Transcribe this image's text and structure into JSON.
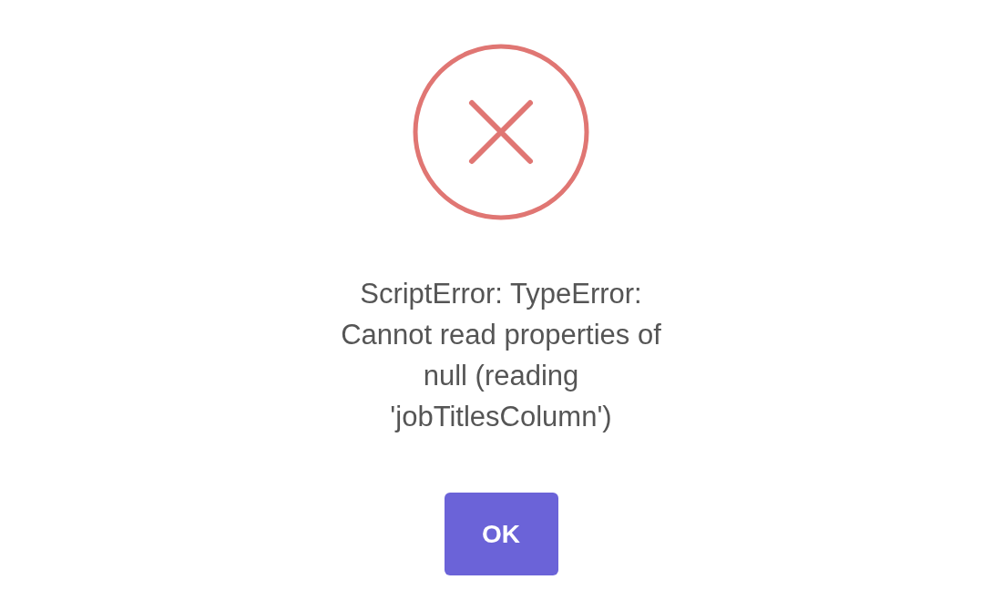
{
  "dialog": {
    "kind": "error",
    "message": "ScriptError: TypeError:\nCannot read properties of\nnull (reading\n'jobTitlesColumn')",
    "button": "OK"
  }
}
